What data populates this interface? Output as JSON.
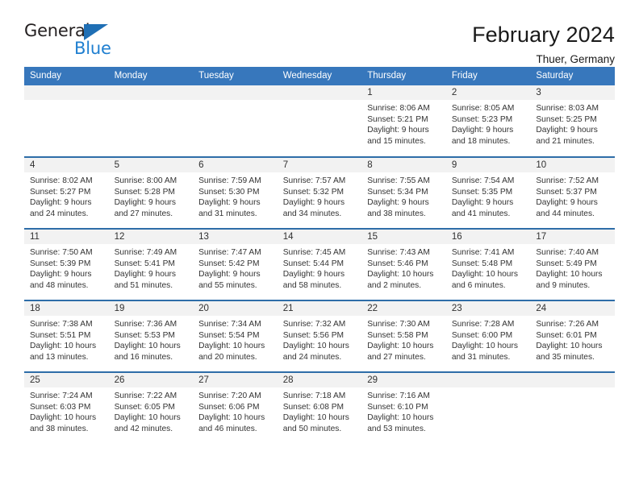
{
  "brand": {
    "name_part1": "General",
    "name_part2": "Blue",
    "triangle_color": "#1f6fb5",
    "blue_color": "#1f7fd0"
  },
  "header": {
    "title": "February 2024",
    "subtitle": "Thuer, Germany"
  },
  "theme": {
    "header_row_bg": "#3777bc",
    "row_border": "#2e6da8",
    "daynum_band_bg": "#f2f2f2"
  },
  "calendar": {
    "weekday_headers": [
      "Sunday",
      "Monday",
      "Tuesday",
      "Wednesday",
      "Thursday",
      "Friday",
      "Saturday"
    ],
    "weeks": [
      [
        {
          "day": "",
          "empty": true
        },
        {
          "day": "",
          "empty": true
        },
        {
          "day": "",
          "empty": true
        },
        {
          "day": "",
          "empty": true
        },
        {
          "day": "1",
          "sunrise": "Sunrise: 8:06 AM",
          "sunset": "Sunset: 5:21 PM",
          "daylight1": "Daylight: 9 hours",
          "daylight2": "and 15 minutes."
        },
        {
          "day": "2",
          "sunrise": "Sunrise: 8:05 AM",
          "sunset": "Sunset: 5:23 PM",
          "daylight1": "Daylight: 9 hours",
          "daylight2": "and 18 minutes."
        },
        {
          "day": "3",
          "sunrise": "Sunrise: 8:03 AM",
          "sunset": "Sunset: 5:25 PM",
          "daylight1": "Daylight: 9 hours",
          "daylight2": "and 21 minutes."
        }
      ],
      [
        {
          "day": "4",
          "sunrise": "Sunrise: 8:02 AM",
          "sunset": "Sunset: 5:27 PM",
          "daylight1": "Daylight: 9 hours",
          "daylight2": "and 24 minutes."
        },
        {
          "day": "5",
          "sunrise": "Sunrise: 8:00 AM",
          "sunset": "Sunset: 5:28 PM",
          "daylight1": "Daylight: 9 hours",
          "daylight2": "and 27 minutes."
        },
        {
          "day": "6",
          "sunrise": "Sunrise: 7:59 AM",
          "sunset": "Sunset: 5:30 PM",
          "daylight1": "Daylight: 9 hours",
          "daylight2": "and 31 minutes."
        },
        {
          "day": "7",
          "sunrise": "Sunrise: 7:57 AM",
          "sunset": "Sunset: 5:32 PM",
          "daylight1": "Daylight: 9 hours",
          "daylight2": "and 34 minutes."
        },
        {
          "day": "8",
          "sunrise": "Sunrise: 7:55 AM",
          "sunset": "Sunset: 5:34 PM",
          "daylight1": "Daylight: 9 hours",
          "daylight2": "and 38 minutes."
        },
        {
          "day": "9",
          "sunrise": "Sunrise: 7:54 AM",
          "sunset": "Sunset: 5:35 PM",
          "daylight1": "Daylight: 9 hours",
          "daylight2": "and 41 minutes."
        },
        {
          "day": "10",
          "sunrise": "Sunrise: 7:52 AM",
          "sunset": "Sunset: 5:37 PM",
          "daylight1": "Daylight: 9 hours",
          "daylight2": "and 44 minutes."
        }
      ],
      [
        {
          "day": "11",
          "sunrise": "Sunrise: 7:50 AM",
          "sunset": "Sunset: 5:39 PM",
          "daylight1": "Daylight: 9 hours",
          "daylight2": "and 48 minutes."
        },
        {
          "day": "12",
          "sunrise": "Sunrise: 7:49 AM",
          "sunset": "Sunset: 5:41 PM",
          "daylight1": "Daylight: 9 hours",
          "daylight2": "and 51 minutes."
        },
        {
          "day": "13",
          "sunrise": "Sunrise: 7:47 AM",
          "sunset": "Sunset: 5:42 PM",
          "daylight1": "Daylight: 9 hours",
          "daylight2": "and 55 minutes."
        },
        {
          "day": "14",
          "sunrise": "Sunrise: 7:45 AM",
          "sunset": "Sunset: 5:44 PM",
          "daylight1": "Daylight: 9 hours",
          "daylight2": "and 58 minutes."
        },
        {
          "day": "15",
          "sunrise": "Sunrise: 7:43 AM",
          "sunset": "Sunset: 5:46 PM",
          "daylight1": "Daylight: 10 hours",
          "daylight2": "and 2 minutes."
        },
        {
          "day": "16",
          "sunrise": "Sunrise: 7:41 AM",
          "sunset": "Sunset: 5:48 PM",
          "daylight1": "Daylight: 10 hours",
          "daylight2": "and 6 minutes."
        },
        {
          "day": "17",
          "sunrise": "Sunrise: 7:40 AM",
          "sunset": "Sunset: 5:49 PM",
          "daylight1": "Daylight: 10 hours",
          "daylight2": "and 9 minutes."
        }
      ],
      [
        {
          "day": "18",
          "sunrise": "Sunrise: 7:38 AM",
          "sunset": "Sunset: 5:51 PM",
          "daylight1": "Daylight: 10 hours",
          "daylight2": "and 13 minutes."
        },
        {
          "day": "19",
          "sunrise": "Sunrise: 7:36 AM",
          "sunset": "Sunset: 5:53 PM",
          "daylight1": "Daylight: 10 hours",
          "daylight2": "and 16 minutes."
        },
        {
          "day": "20",
          "sunrise": "Sunrise: 7:34 AM",
          "sunset": "Sunset: 5:54 PM",
          "daylight1": "Daylight: 10 hours",
          "daylight2": "and 20 minutes."
        },
        {
          "day": "21",
          "sunrise": "Sunrise: 7:32 AM",
          "sunset": "Sunset: 5:56 PM",
          "daylight1": "Daylight: 10 hours",
          "daylight2": "and 24 minutes."
        },
        {
          "day": "22",
          "sunrise": "Sunrise: 7:30 AM",
          "sunset": "Sunset: 5:58 PM",
          "daylight1": "Daylight: 10 hours",
          "daylight2": "and 27 minutes."
        },
        {
          "day": "23",
          "sunrise": "Sunrise: 7:28 AM",
          "sunset": "Sunset: 6:00 PM",
          "daylight1": "Daylight: 10 hours",
          "daylight2": "and 31 minutes."
        },
        {
          "day": "24",
          "sunrise": "Sunrise: 7:26 AM",
          "sunset": "Sunset: 6:01 PM",
          "daylight1": "Daylight: 10 hours",
          "daylight2": "and 35 minutes."
        }
      ],
      [
        {
          "day": "25",
          "sunrise": "Sunrise: 7:24 AM",
          "sunset": "Sunset: 6:03 PM",
          "daylight1": "Daylight: 10 hours",
          "daylight2": "and 38 minutes."
        },
        {
          "day": "26",
          "sunrise": "Sunrise: 7:22 AM",
          "sunset": "Sunset: 6:05 PM",
          "daylight1": "Daylight: 10 hours",
          "daylight2": "and 42 minutes."
        },
        {
          "day": "27",
          "sunrise": "Sunrise: 7:20 AM",
          "sunset": "Sunset: 6:06 PM",
          "daylight1": "Daylight: 10 hours",
          "daylight2": "and 46 minutes."
        },
        {
          "day": "28",
          "sunrise": "Sunrise: 7:18 AM",
          "sunset": "Sunset: 6:08 PM",
          "daylight1": "Daylight: 10 hours",
          "daylight2": "and 50 minutes."
        },
        {
          "day": "29",
          "sunrise": "Sunrise: 7:16 AM",
          "sunset": "Sunset: 6:10 PM",
          "daylight1": "Daylight: 10 hours",
          "daylight2": "and 53 minutes."
        },
        {
          "day": "",
          "empty": true
        },
        {
          "day": "",
          "empty": true
        }
      ]
    ]
  }
}
